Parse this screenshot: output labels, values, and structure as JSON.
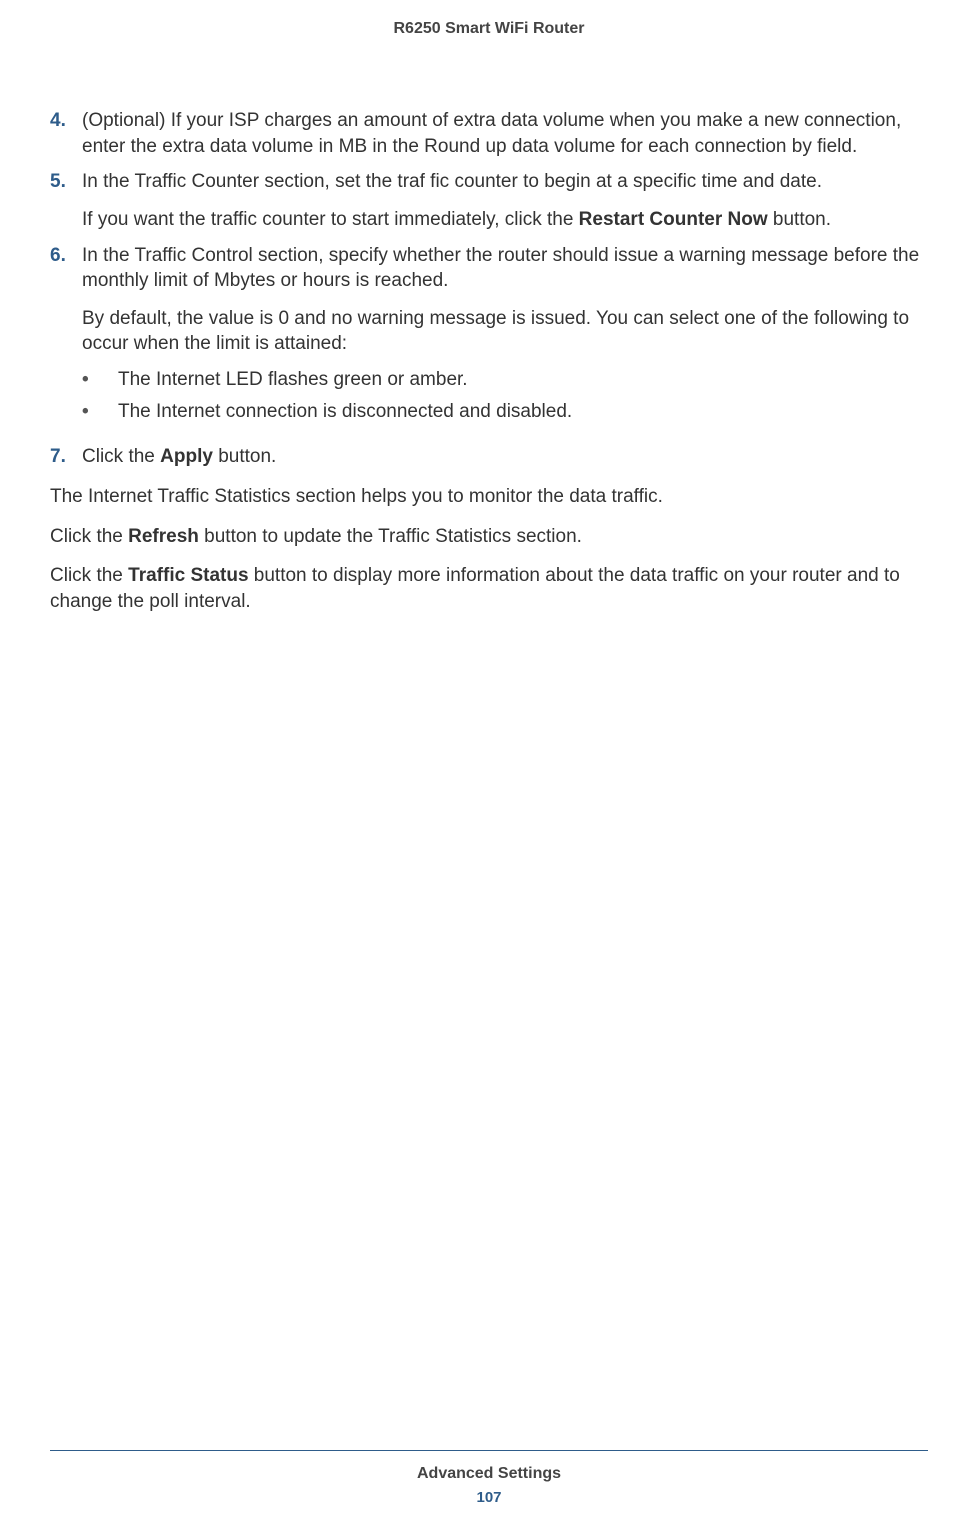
{
  "header": {
    "title": "R6250 Smart WiFi Router"
  },
  "steps": {
    "s4": {
      "num": "4.",
      "text": "(Optional) If your ISP charges an amount of extra data volume when you make a new connection, enter the extra data volume in MB in the Round up data volume for each connection by field."
    },
    "s5": {
      "num": "5.",
      "text": "In the Traffic Counter section, set the traf fic counter to begin at a specific time and date.",
      "para_pre": "If you want the traffic counter to start immediately, click the ",
      "para_bold": "Restart Counter Now",
      "para_post": " button."
    },
    "s6": {
      "num": "6.",
      "text": "In the Traffic Control section, specify whether the router should issue a warning message before the monthly limit of Mbytes or hours is reached.",
      "para": "By default, the value is 0 and no warning message is issued. You can select one of the following to occur when the limit is attained:",
      "bullets": {
        "b1": "The Internet LED flashes green or amber.",
        "b2": "The Internet connection is disconnected and disabled."
      }
    },
    "s7": {
      "num": "7.",
      "text_pre": "Click the ",
      "text_bold": "Apply",
      "text_post": " button."
    }
  },
  "body": {
    "p1": "The Internet Traffic Statistics section helps you to monitor the data traffic.",
    "p2_pre": "Click the ",
    "p2_bold": "Refresh",
    "p2_post": " button to update the Traffic Statistics section.",
    "p3_pre": "Click the ",
    "p3_bold": "Traffic Status",
    "p3_post": " button to display more information about the data traffic on your router and to change the poll interval."
  },
  "footer": {
    "section": "Advanced Settings",
    "page": "107"
  },
  "bullet_char": "•"
}
